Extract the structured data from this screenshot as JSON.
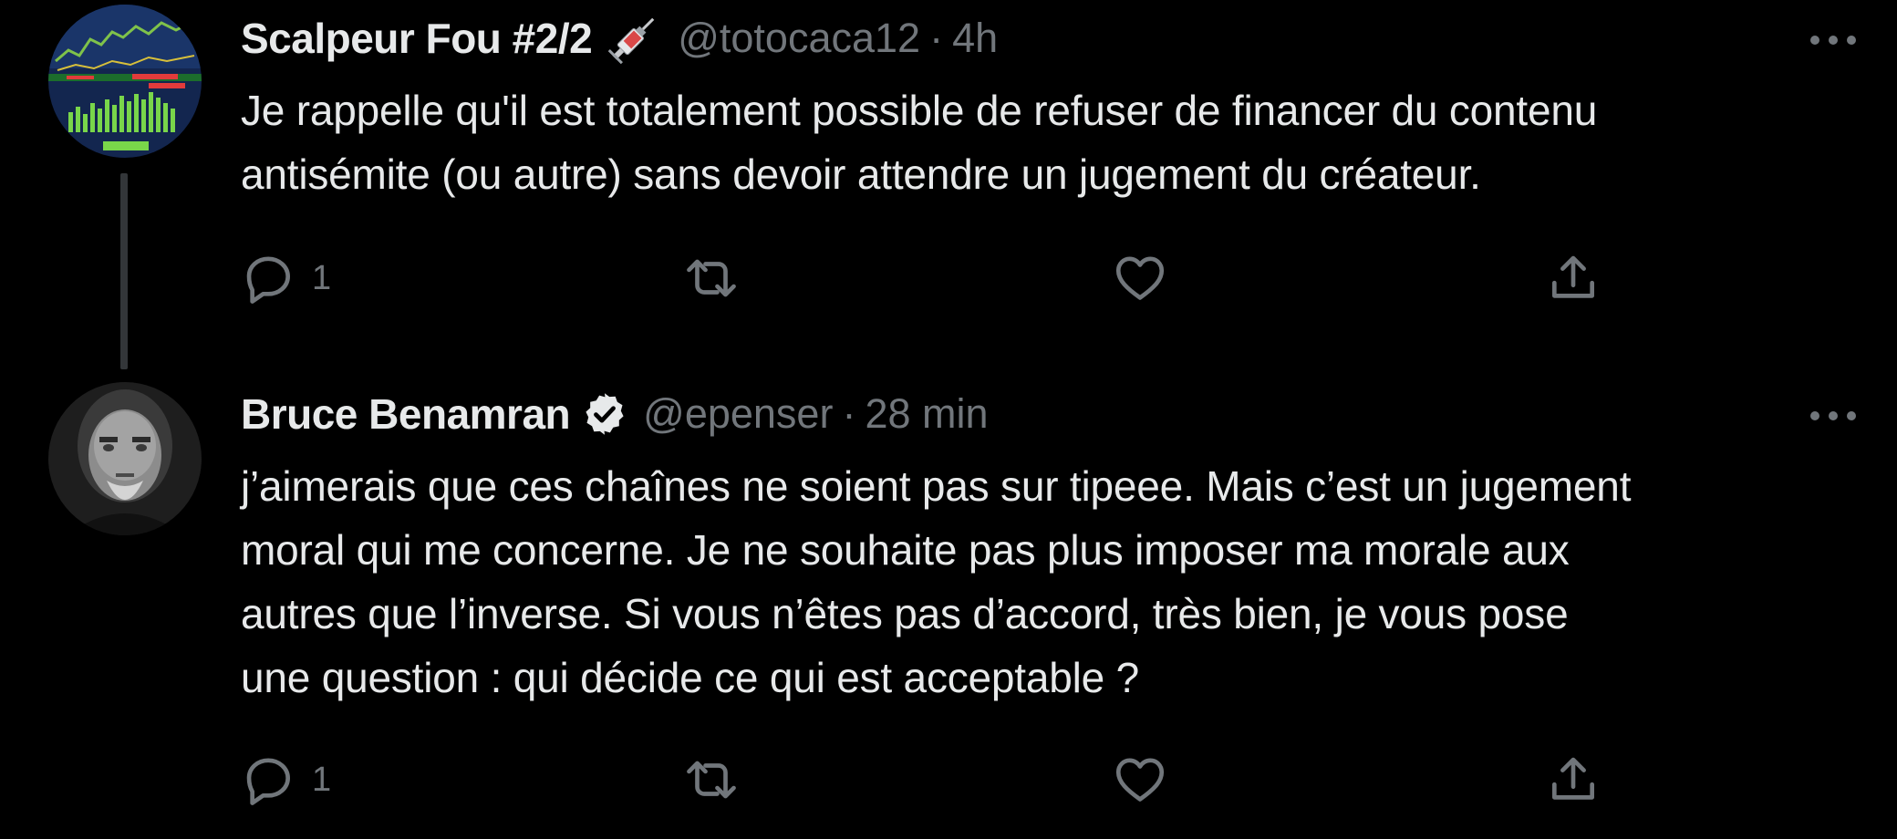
{
  "colors": {
    "background": "#000000",
    "text_primary": "#e7e9ea",
    "text_secondary": "#71767b",
    "thread_line": "#333639"
  },
  "tweets": [
    {
      "name": "Scalpeur Fou #2/2",
      "name_emoji": "syringe-icon",
      "handle": "@totocaca12",
      "separator": "·",
      "time": "4h",
      "text_lines": [
        "Je rappelle qu'il est totalement possible de refuser de financer du contenu",
        "antisémite (ou autre) sans devoir attendre un jugement du créateur."
      ],
      "reply_count": "1",
      "retweet_count": "",
      "like_count": ""
    },
    {
      "name": "Bruce Benamran",
      "verified": true,
      "handle": "@epenser",
      "separator": "·",
      "time": "28 min",
      "text_lines": [
        "j’aimerais que ces chaînes ne soient pas sur tipeee. Mais c’est un jugement",
        "moral qui me concerne. Je ne souhaite pas plus imposer ma morale aux",
        "autres que l’inverse. Si vous n’êtes pas d’accord, très bien, je vous pose",
        "une question : qui décide ce qui est acceptable ?"
      ],
      "reply_count": "1",
      "retweet_count": "",
      "like_count": ""
    }
  ]
}
